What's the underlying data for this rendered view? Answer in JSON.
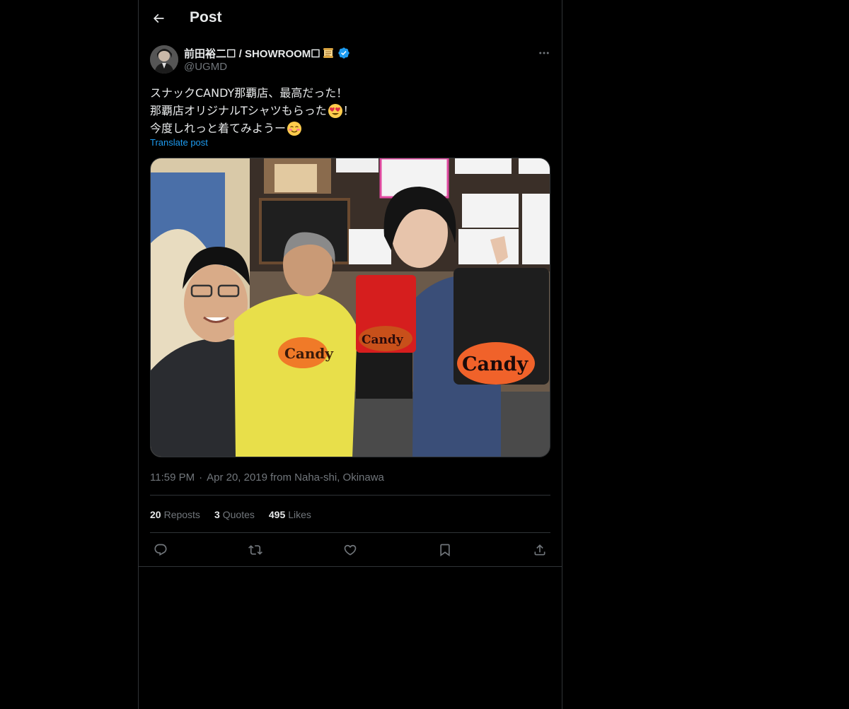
{
  "header": {
    "title": "Post",
    "back_icon": "arrow-left-icon"
  },
  "author": {
    "display_name": "前田裕二☐ / SHOWROOM☐",
    "name_emoji": "scroll-icon",
    "verified_icon": "verified-badge-icon",
    "handle": "@UGMD"
  },
  "post": {
    "lines": [
      {
        "text": "スナックCANDY那覇店、最高だった！",
        "emoji": null,
        "after": ""
      },
      {
        "text": "那覇店オリジナルTシャツもらった",
        "emoji": "heart-eyes-emoji",
        "after": "！"
      },
      {
        "text": "今度しれっと着てみようー",
        "emoji": "smiling-blush-emoji",
        "after": ""
      }
    ],
    "translate": "Translate post"
  },
  "meta": {
    "time": "11:59 PM",
    "separator": "·",
    "date": "Apr 20, 2019",
    "location": "from Naha-shi, Okinawa"
  },
  "stats": {
    "reposts_count": "20",
    "reposts_label": "Reposts",
    "quotes_count": "3",
    "quotes_label": "Quotes",
    "likes_count": "495",
    "likes_label": "Likes"
  },
  "actions": [
    "reply-icon",
    "repost-icon",
    "like-icon",
    "bookmark-icon",
    "share-icon"
  ],
  "colors": {
    "background": "#000000",
    "text": "#e7e9ea",
    "muted": "#71767b",
    "accent": "#1d9bf0",
    "border": "#2f3336"
  }
}
